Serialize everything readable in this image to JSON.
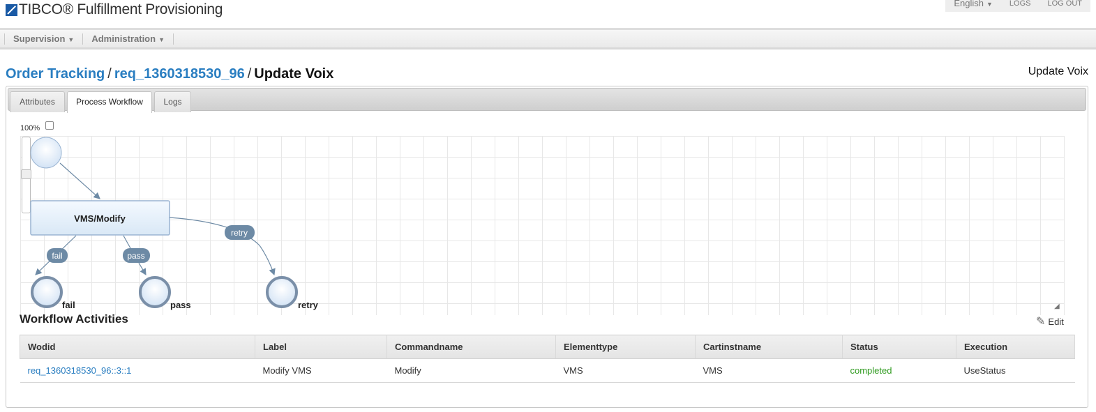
{
  "header": {
    "logo_text": "TIBCO® Fulfillment Provisioning",
    "language": "English",
    "logs_link": "LOGS",
    "logout_link": "LOG OUT"
  },
  "menubar": {
    "items": [
      {
        "label": "Supervision"
      },
      {
        "label": "Administration"
      }
    ]
  },
  "breadcrumb": {
    "root": "Order Tracking",
    "request": "req_1360318530_96",
    "current": "Update Voix"
  },
  "page_title_right": "Update Voix",
  "tabs": [
    {
      "label": "Attributes",
      "active": false
    },
    {
      "label": "Process Workflow",
      "active": true
    },
    {
      "label": "Logs",
      "active": false
    }
  ],
  "workflow": {
    "zoom": "100%",
    "main_node": "VMS/Modify",
    "edges": [
      "fail",
      "pass",
      "retry"
    ],
    "end_nodes": [
      "fail",
      "pass",
      "retry"
    ]
  },
  "activities": {
    "title": "Workflow Activities",
    "edit_label": "Edit",
    "columns": [
      "Wodid",
      "Label",
      "Commandname",
      "Elementtype",
      "Cartinstname",
      "Status",
      "Execution"
    ],
    "rows": [
      [
        "req_1360318530_96::3::1",
        "Modify VMS",
        "Modify",
        "VMS",
        "VMS",
        "completed",
        "UseStatus"
      ]
    ],
    "status_color": "#2e9a1e"
  },
  "colors": {
    "link": "#2a7ec1",
    "node_fill": "#e6f0fa",
    "edge_label_bg": "#6d8aa5",
    "end_node_stroke": "#7a8fa8"
  }
}
